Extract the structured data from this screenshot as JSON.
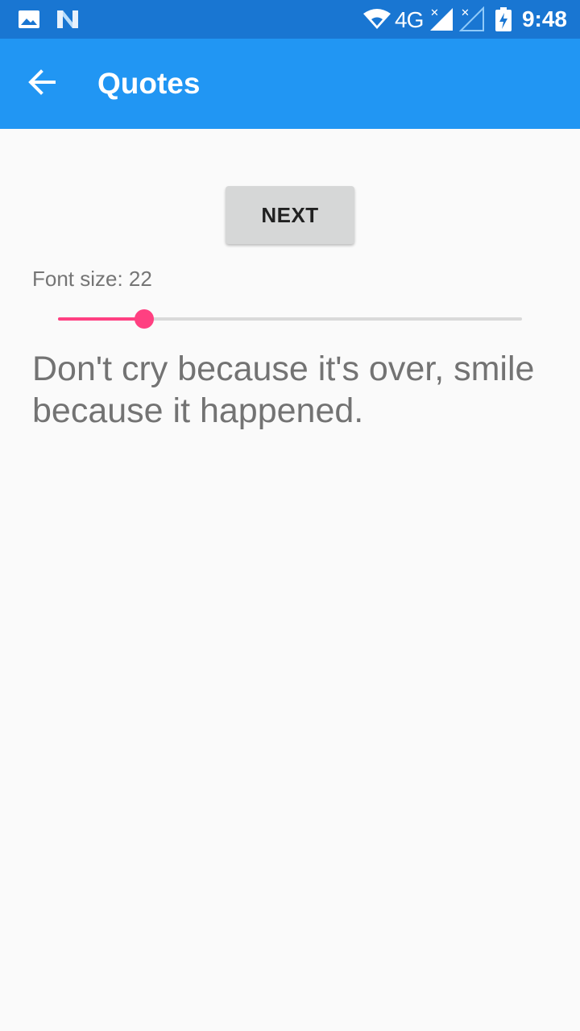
{
  "status_bar": {
    "time": "9:48",
    "network": "4G",
    "icons": [
      "image-icon",
      "n-icon",
      "wifi-icon",
      "signal-icon",
      "signal-empty-icon",
      "battery-charging-icon"
    ]
  },
  "app_bar": {
    "title": "Quotes",
    "back_icon": "arrow-back-icon"
  },
  "main": {
    "next_button_label": "NEXT",
    "font_size_label": "Font size: 22",
    "slider": {
      "value": 0.185,
      "accent_color": "#ff4081"
    },
    "quote": "Don't cry because it's over, smile because it happened."
  },
  "colors": {
    "status_bar": "#1976d2",
    "app_bar": "#2196f3",
    "background": "#fafafa"
  }
}
